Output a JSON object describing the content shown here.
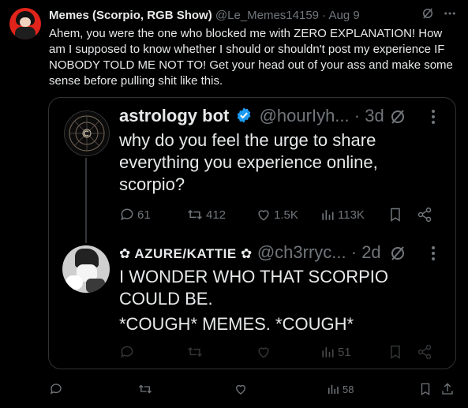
{
  "post": {
    "author_name": "Memes (Scorpio, RGB Show)",
    "author_handle": "@Le_Memes14159",
    "separator": "·",
    "date": "Aug 9",
    "text": "Ahem, you were the one who blocked me with ZERO EXPLANATION! How am I supposed to know whether I should or shouldn't post my experience IF NOBODY TOLD ME NOT TO! Get your head out of your ass and make some sense before pulling shit like this.",
    "views": "58"
  },
  "quote": {
    "first": {
      "author_name": "astrology bot",
      "author_handle": "@hourIyh...",
      "time": "· 3d",
      "text": "why do you feel the urge to share everything you experience online, scorpio?",
      "replies": "61",
      "reposts": "412",
      "likes": "1.5K",
      "views": "113K"
    },
    "second": {
      "author_name": "✿ AZURE/KATTIE ✿",
      "author_handle": "@ch3rryc...",
      "time": "· 2d",
      "text_line1": "I WONDER WHO THAT SCORPIO COULD BE.",
      "text_line2": "*COUGH* MEMES. *COUGH*",
      "views": "51"
    }
  },
  "colors": {
    "background": "#000000",
    "text": "#e7e9ea",
    "muted": "#71767b",
    "verified": "#1d9bf0",
    "border": "#2f3336"
  }
}
